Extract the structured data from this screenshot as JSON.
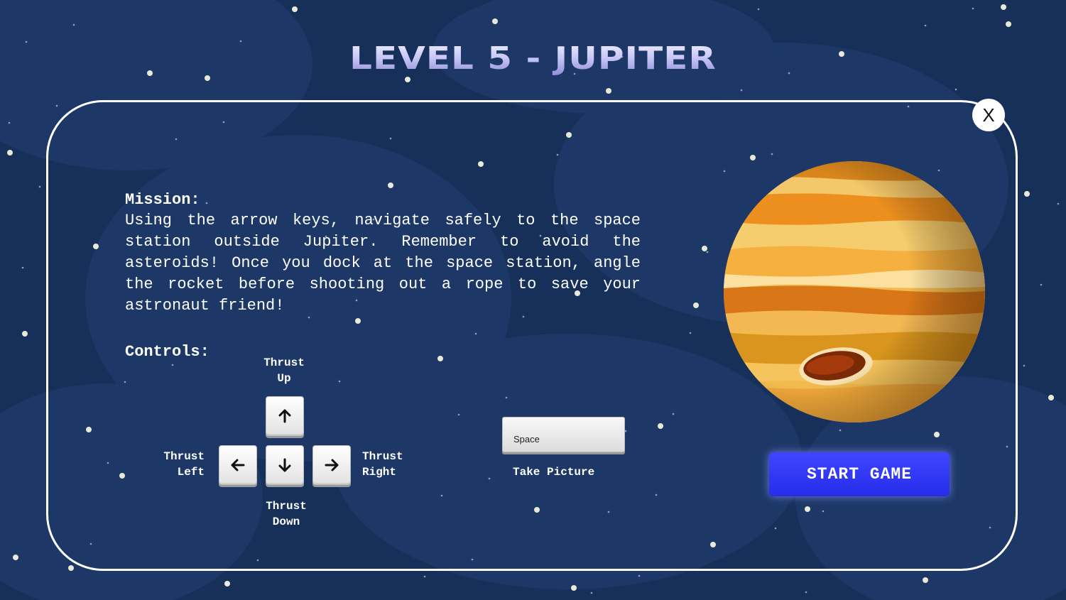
{
  "title": "LEVEL 5 - JUPITER",
  "close_label": "X",
  "mission": {
    "label": "Mission:",
    "text": "Using the arrow keys, navigate safely to the space station outside Jupiter. Remember to avoid the asteroids! Once you dock at the space station, angle the rocket before shooting out a rope to save your astronaut friend!"
  },
  "controls": {
    "label": "Controls:",
    "up": {
      "line1": "Thrust",
      "line2": "Up",
      "icon": "arrow-up-icon"
    },
    "left": {
      "line1": "Thrust",
      "line2": "Left",
      "icon": "arrow-left-icon"
    },
    "down": {
      "line1": "Thrust",
      "line2": "Down",
      "icon": "arrow-down-icon"
    },
    "right": {
      "line1": "Thrust",
      "line2": "Right",
      "icon": "arrow-right-icon"
    },
    "space": {
      "key_label": "Space",
      "action": "Take Picture"
    }
  },
  "start_button": "START GAME",
  "colors": {
    "background": "#16305a",
    "start_button": "#2f35f5",
    "panel_border": "#ffffff"
  }
}
